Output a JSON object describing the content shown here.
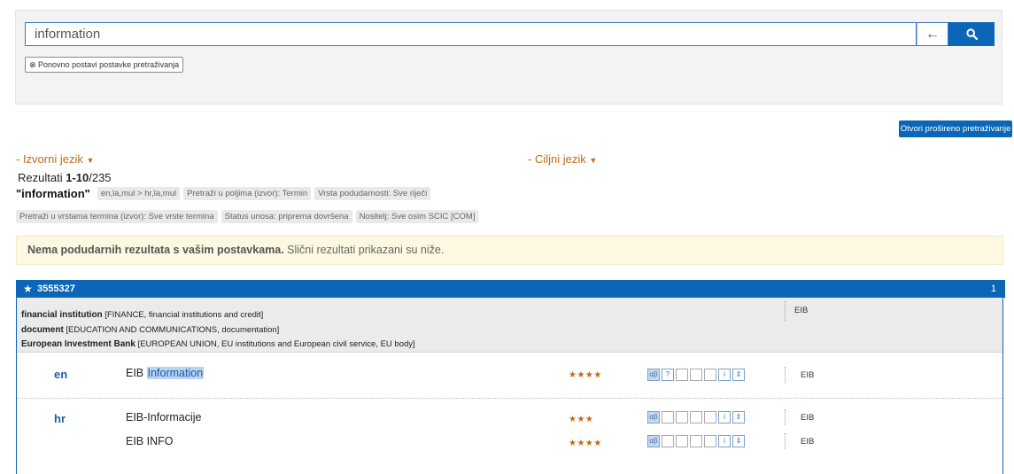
{
  "search": {
    "query": "information",
    "back_icon": "arrow-left-icon",
    "search_icon": "search-icon",
    "reset_label": "⊗ Ponovno postavi postavke pretraživanja"
  },
  "advanced_search_label": "Otvori prošireno pretraživanje",
  "source_lang_label": "- Izvorni jezik",
  "target_lang_label": "- Ciljni jezik",
  "results": {
    "label": "Rezultati ",
    "range": "1-10",
    "total": "/235",
    "query_term": "\"information\"",
    "filters_row1": [
      "en,la,mul > hr,la,mul",
      "Pretraži u poljima (izvor): Termin",
      "Vrsta podudarnosti: Sve riječi"
    ],
    "filters_row2": [
      "Pretraži u vrstama termina (izvor): Sve vrste termina",
      "Status unosa: priprema dovršena",
      "Nositelj: Sve osim SCIC [COM]"
    ]
  },
  "notice": {
    "bold": "Nema podudarnih rezultata s vašim postavkama.",
    "rest": " Slični rezultati prikazani su niže."
  },
  "entry": {
    "id": "3555327",
    "page": "1",
    "domains": [
      {
        "term": "financial institution",
        "detail": " [FINANCE, financial institutions and credit]"
      },
      {
        "term": "document",
        "detail": " [EDUCATION AND COMMUNICATIONS, documentation]"
      },
      {
        "term": "European Investment Bank",
        "detail": " [EUROPEAN UNION, EU institutions and European civil service, EU body]"
      }
    ],
    "domain_code": "EIB",
    "languages": [
      {
        "code": "en",
        "terms": [
          {
            "prefix": "EIB ",
            "highlight": "Information",
            "rest": "",
            "rating": "★★★★",
            "source": "EIB"
          }
        ]
      },
      {
        "code": "hr",
        "terms": [
          {
            "prefix": "EIB-Informacije",
            "highlight": "",
            "rest": "",
            "rating": "★★★",
            "source": "EIB"
          },
          {
            "prefix": "EIB INFO",
            "highlight": "",
            "rest": "",
            "rating": "★★★★",
            "source": "EIB"
          }
        ]
      }
    ]
  },
  "colors": {
    "primary": "#0c66b8",
    "accent_orange": "#c26a17",
    "notice_bg": "#fcf8e1",
    "highlight": "#b8d4f1"
  }
}
